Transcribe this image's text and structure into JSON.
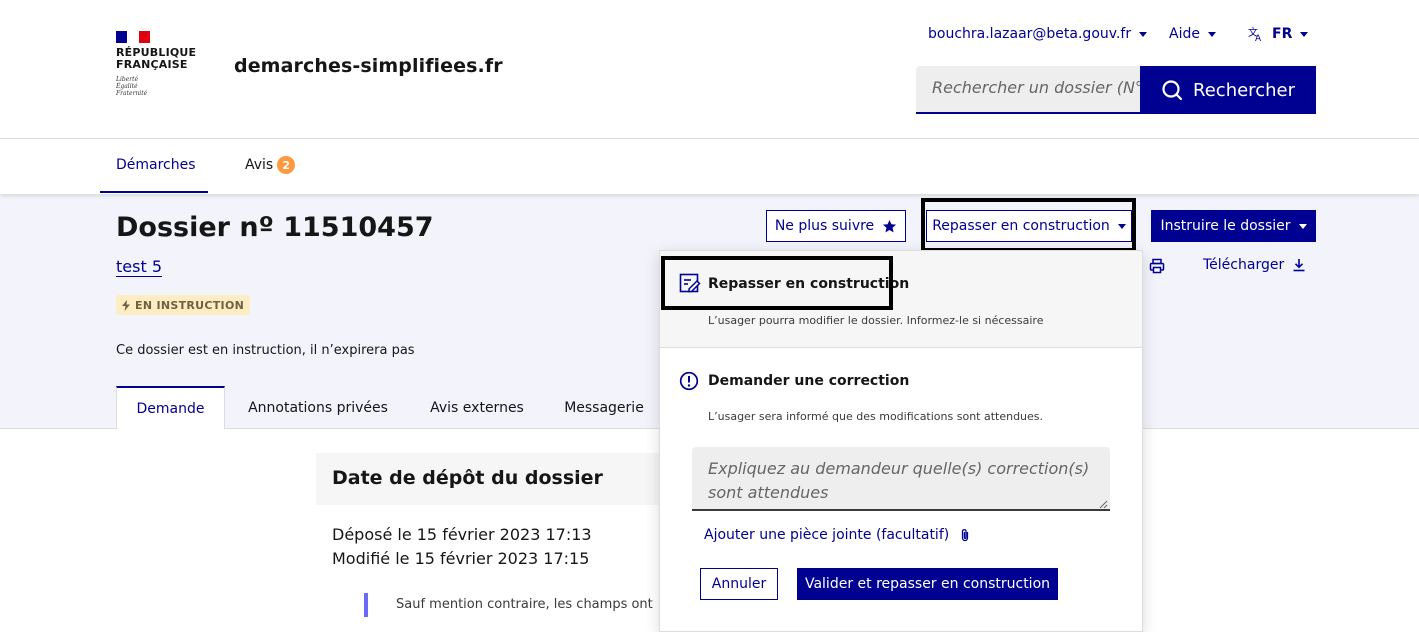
{
  "header": {
    "republique_line1": "RÉPUBLIQUE",
    "republique_line2": "FRANÇAISE",
    "devise_1": "Liberté",
    "devise_2": "Égalité",
    "devise_3": "Fraternité",
    "site_name": "demarches-simplifiees.fr",
    "user_email": "bouchra.lazaar@beta.gouv.fr",
    "help_label": "Aide",
    "lang_label": "FR",
    "search_placeholder": "Rechercher un dossier (N°",
    "search_button": "Rechercher",
    "flag_colors": [
      "#000091",
      "#ffffff",
      "#e1000f"
    ]
  },
  "nav": {
    "items": [
      {
        "label": "Démarches",
        "active": true
      },
      {
        "label": "Avis",
        "badge": "2"
      }
    ]
  },
  "dossier": {
    "title": "Dossier nº 11510457",
    "procedure_link": "test 5",
    "status": "EN INSTRUCTION",
    "expiration_notice": "Ce dossier est en instruction, il n’expirera pas"
  },
  "actions": {
    "unfollow": "Ne plus suivre",
    "back_to_construction": "Repasser en construction",
    "instruct": "Instruire le dossier",
    "download": "Télécharger"
  },
  "tabs": [
    {
      "label": "Demande",
      "active": true
    },
    {
      "label": "Annotations privées"
    },
    {
      "label": "Avis externes"
    },
    {
      "label": "Messagerie"
    }
  ],
  "content": {
    "section_title": "Date de dépôt du dossier",
    "deposited": "Déposé le 15 février 2023 17:13",
    "modified": "Modifié le 15 février 2023 17:15",
    "callout": "Sauf mention contraire, les champs ont"
  },
  "dropdown": {
    "option1_title": "Repasser en construction",
    "option1_desc": "L’usager pourra modifier le dossier. Informez-le si nécessaire",
    "option2_title": "Demander une correction",
    "option2_desc": "L’usager sera informé que des modifications sont attendues.",
    "textarea_placeholder": "Expliquez au demandeur quelle(s) correction(s) sont attendues",
    "attachment_label": "Ajouter une pièce jointe (facultatif)",
    "cancel": "Annuler",
    "confirm": "Valider et repasser en construction"
  },
  "colors": {
    "primary": "#000091",
    "badge": "#ff9940",
    "status_bg": "#feecc2",
    "subheader_bg": "#f3f3fb"
  }
}
